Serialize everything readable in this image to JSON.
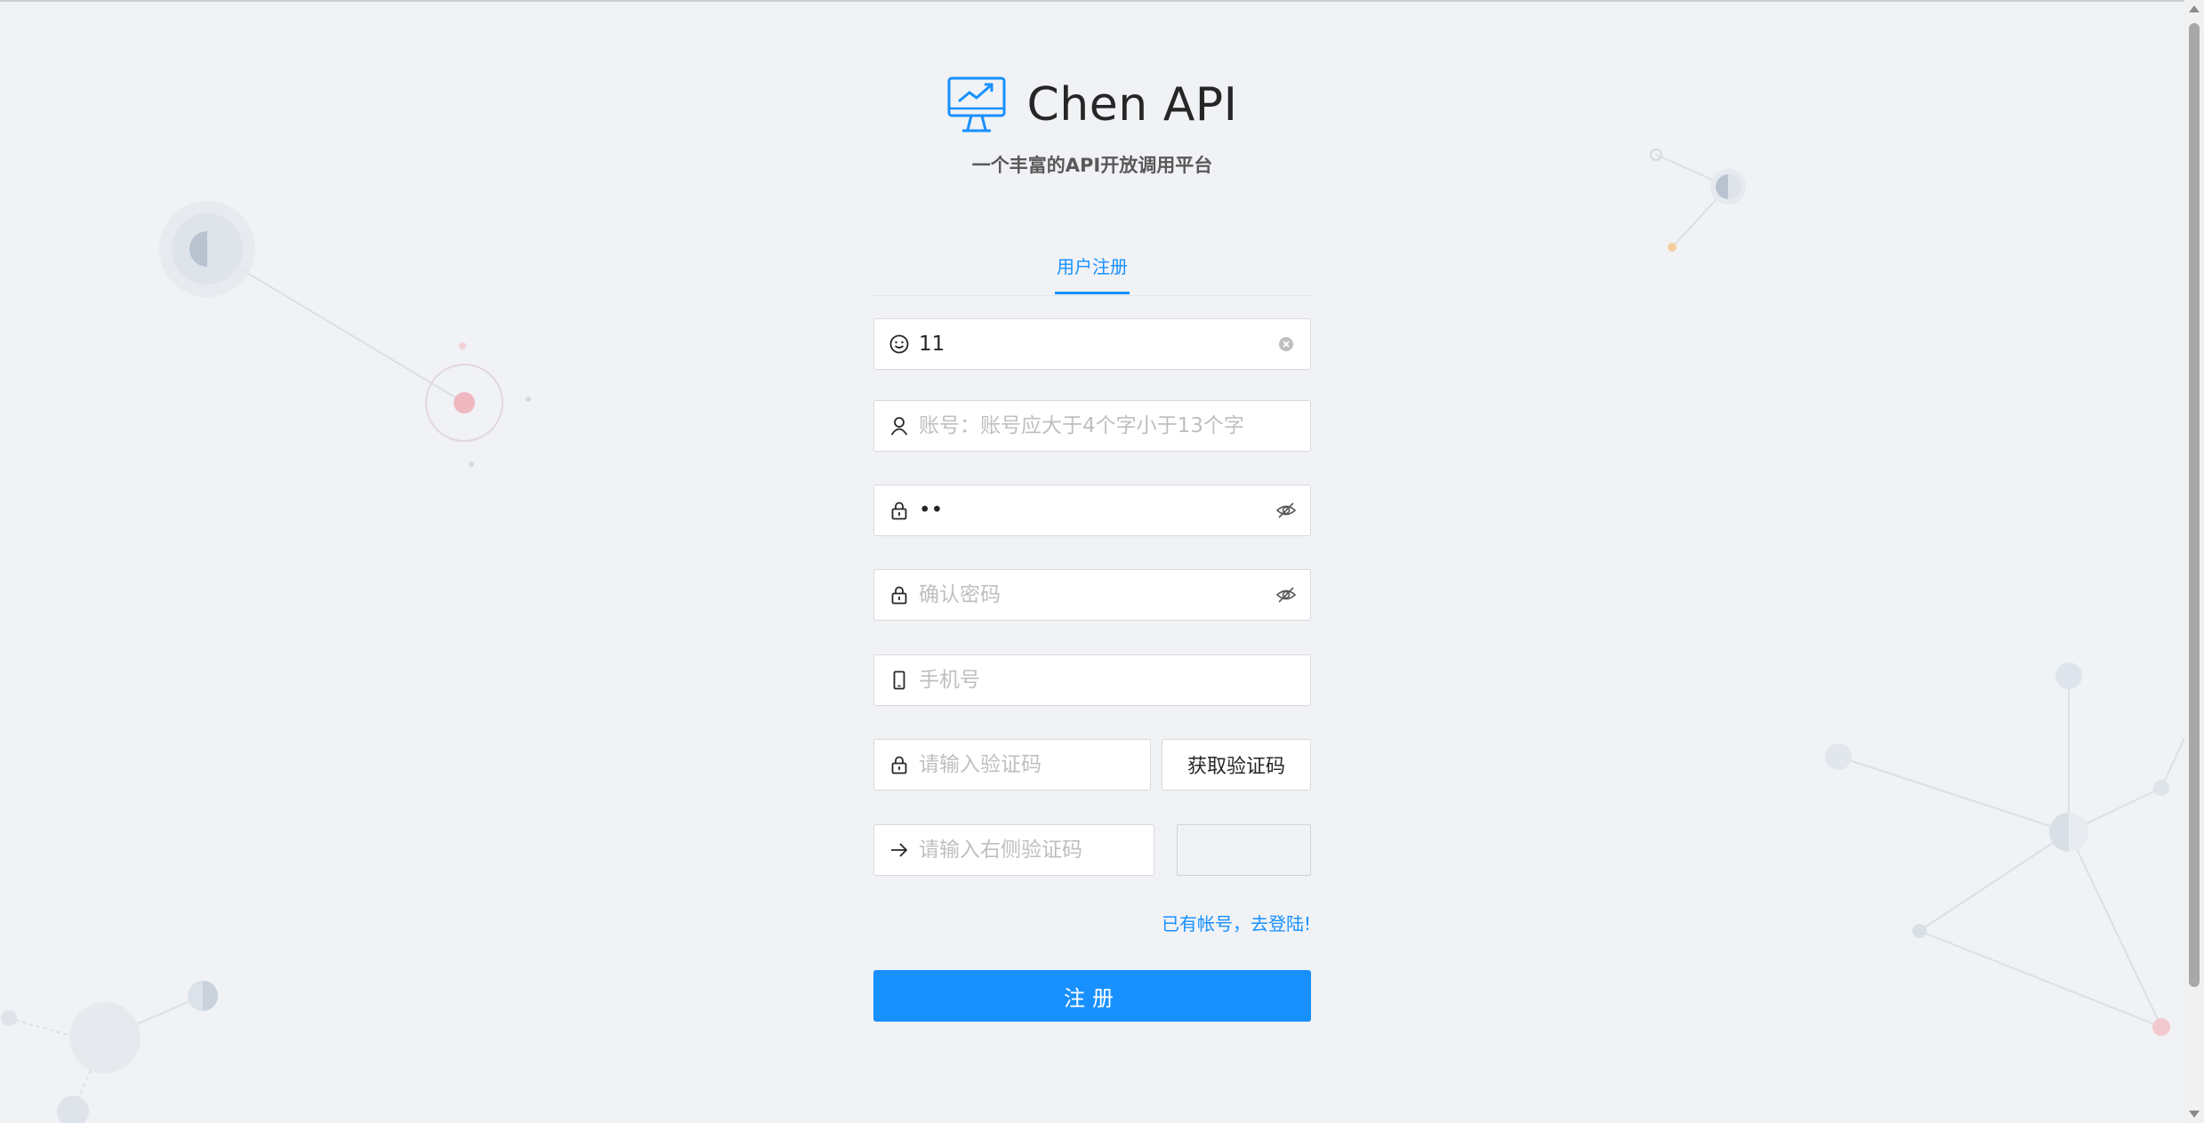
{
  "app": {
    "title": "Chen API",
    "subtitle": "一个丰富的API开放调用平台"
  },
  "tabs": [
    {
      "label": "用户注册",
      "active": true
    }
  ],
  "form": {
    "nickname": {
      "value": "11",
      "icon": "smile-icon"
    },
    "account": {
      "value": "",
      "placeholder": "账号：账号应大于4个字小于13个字",
      "icon": "user-icon"
    },
    "password": {
      "value": "••",
      "icon": "lock-icon"
    },
    "confirm_password": {
      "value": "",
      "placeholder": "确认密码",
      "icon": "lock-icon"
    },
    "phone": {
      "value": "",
      "placeholder": "手机号",
      "icon": "mobile-icon"
    },
    "sms_code": {
      "value": "",
      "placeholder": "请输入验证码",
      "icon": "lock-icon"
    },
    "get_code_label": "获取验证码",
    "image_code": {
      "value": "",
      "placeholder": "请输入右侧验证码",
      "icon": "arrow-right-icon"
    },
    "login_link": "已有帐号，去登陆!",
    "submit_label": "注册"
  },
  "colors": {
    "primary": "#1890ff",
    "background": "#f0f2f5",
    "placeholder": "#bfbfbf",
    "border": "#d9d9d9"
  }
}
